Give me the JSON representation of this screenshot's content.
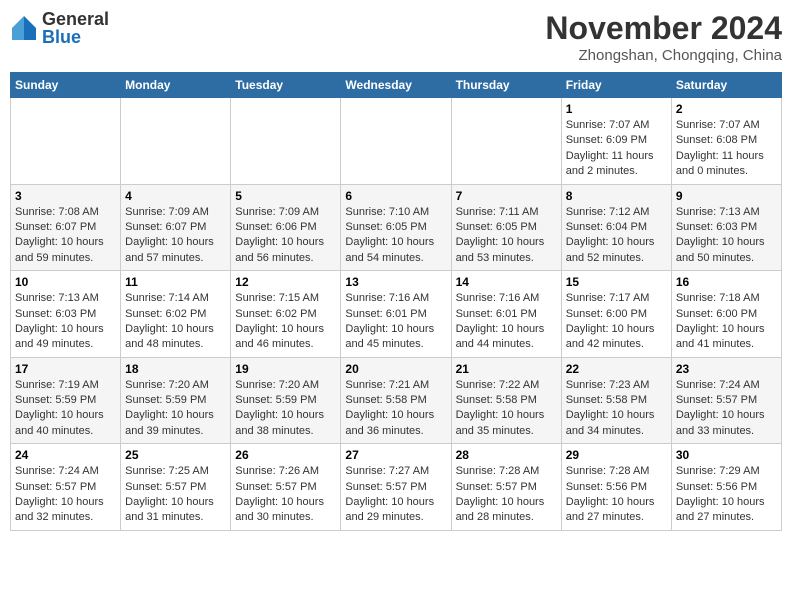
{
  "header": {
    "logo": {
      "general": "General",
      "blue": "Blue"
    },
    "title": "November 2024",
    "location": "Zhongshan, Chongqing, China"
  },
  "days_of_week": [
    "Sunday",
    "Monday",
    "Tuesday",
    "Wednesday",
    "Thursday",
    "Friday",
    "Saturday"
  ],
  "weeks": [
    [
      {
        "day": "",
        "info": ""
      },
      {
        "day": "",
        "info": ""
      },
      {
        "day": "",
        "info": ""
      },
      {
        "day": "",
        "info": ""
      },
      {
        "day": "",
        "info": ""
      },
      {
        "day": "1",
        "info": "Sunrise: 7:07 AM\nSunset: 6:09 PM\nDaylight: 11 hours and 2 minutes."
      },
      {
        "day": "2",
        "info": "Sunrise: 7:07 AM\nSunset: 6:08 PM\nDaylight: 11 hours and 0 minutes."
      }
    ],
    [
      {
        "day": "3",
        "info": "Sunrise: 7:08 AM\nSunset: 6:07 PM\nDaylight: 10 hours and 59 minutes."
      },
      {
        "day": "4",
        "info": "Sunrise: 7:09 AM\nSunset: 6:07 PM\nDaylight: 10 hours and 57 minutes."
      },
      {
        "day": "5",
        "info": "Sunrise: 7:09 AM\nSunset: 6:06 PM\nDaylight: 10 hours and 56 minutes."
      },
      {
        "day": "6",
        "info": "Sunrise: 7:10 AM\nSunset: 6:05 PM\nDaylight: 10 hours and 54 minutes."
      },
      {
        "day": "7",
        "info": "Sunrise: 7:11 AM\nSunset: 6:05 PM\nDaylight: 10 hours and 53 minutes."
      },
      {
        "day": "8",
        "info": "Sunrise: 7:12 AM\nSunset: 6:04 PM\nDaylight: 10 hours and 52 minutes."
      },
      {
        "day": "9",
        "info": "Sunrise: 7:13 AM\nSunset: 6:03 PM\nDaylight: 10 hours and 50 minutes."
      }
    ],
    [
      {
        "day": "10",
        "info": "Sunrise: 7:13 AM\nSunset: 6:03 PM\nDaylight: 10 hours and 49 minutes."
      },
      {
        "day": "11",
        "info": "Sunrise: 7:14 AM\nSunset: 6:02 PM\nDaylight: 10 hours and 48 minutes."
      },
      {
        "day": "12",
        "info": "Sunrise: 7:15 AM\nSunset: 6:02 PM\nDaylight: 10 hours and 46 minutes."
      },
      {
        "day": "13",
        "info": "Sunrise: 7:16 AM\nSunset: 6:01 PM\nDaylight: 10 hours and 45 minutes."
      },
      {
        "day": "14",
        "info": "Sunrise: 7:16 AM\nSunset: 6:01 PM\nDaylight: 10 hours and 44 minutes."
      },
      {
        "day": "15",
        "info": "Sunrise: 7:17 AM\nSunset: 6:00 PM\nDaylight: 10 hours and 42 minutes."
      },
      {
        "day": "16",
        "info": "Sunrise: 7:18 AM\nSunset: 6:00 PM\nDaylight: 10 hours and 41 minutes."
      }
    ],
    [
      {
        "day": "17",
        "info": "Sunrise: 7:19 AM\nSunset: 5:59 PM\nDaylight: 10 hours and 40 minutes."
      },
      {
        "day": "18",
        "info": "Sunrise: 7:20 AM\nSunset: 5:59 PM\nDaylight: 10 hours and 39 minutes."
      },
      {
        "day": "19",
        "info": "Sunrise: 7:20 AM\nSunset: 5:59 PM\nDaylight: 10 hours and 38 minutes."
      },
      {
        "day": "20",
        "info": "Sunrise: 7:21 AM\nSunset: 5:58 PM\nDaylight: 10 hours and 36 minutes."
      },
      {
        "day": "21",
        "info": "Sunrise: 7:22 AM\nSunset: 5:58 PM\nDaylight: 10 hours and 35 minutes."
      },
      {
        "day": "22",
        "info": "Sunrise: 7:23 AM\nSunset: 5:58 PM\nDaylight: 10 hours and 34 minutes."
      },
      {
        "day": "23",
        "info": "Sunrise: 7:24 AM\nSunset: 5:57 PM\nDaylight: 10 hours and 33 minutes."
      }
    ],
    [
      {
        "day": "24",
        "info": "Sunrise: 7:24 AM\nSunset: 5:57 PM\nDaylight: 10 hours and 32 minutes."
      },
      {
        "day": "25",
        "info": "Sunrise: 7:25 AM\nSunset: 5:57 PM\nDaylight: 10 hours and 31 minutes."
      },
      {
        "day": "26",
        "info": "Sunrise: 7:26 AM\nSunset: 5:57 PM\nDaylight: 10 hours and 30 minutes."
      },
      {
        "day": "27",
        "info": "Sunrise: 7:27 AM\nSunset: 5:57 PM\nDaylight: 10 hours and 29 minutes."
      },
      {
        "day": "28",
        "info": "Sunrise: 7:28 AM\nSunset: 5:57 PM\nDaylight: 10 hours and 28 minutes."
      },
      {
        "day": "29",
        "info": "Sunrise: 7:28 AM\nSunset: 5:56 PM\nDaylight: 10 hours and 27 minutes."
      },
      {
        "day": "30",
        "info": "Sunrise: 7:29 AM\nSunset: 5:56 PM\nDaylight: 10 hours and 27 minutes."
      }
    ]
  ]
}
